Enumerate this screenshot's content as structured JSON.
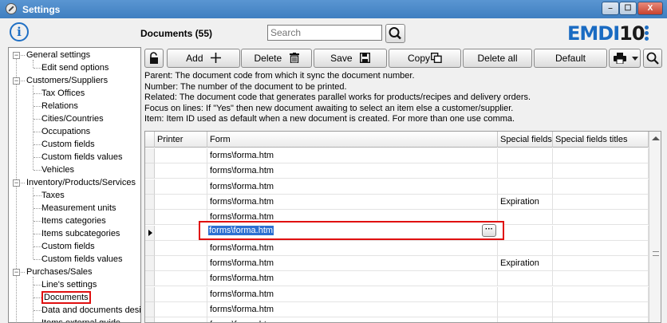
{
  "window": {
    "title": "Settings",
    "min": "–",
    "max": "☐",
    "close": "X"
  },
  "header": {
    "info_glyph": "i",
    "title": "Documents (55)",
    "search_placeholder": "Search",
    "logo_part1": "EMDI",
    "logo_part2": "10"
  },
  "toolbar": {
    "add": "Add",
    "delete": "Delete",
    "save": "Save",
    "copy": "Copy",
    "delete_all": "Delete all",
    "default": "Default"
  },
  "description": [
    "Parent: The document code from which it sync the document number.",
    "Number: The number of the document to be printed.",
    "Related: The document code that generates parallel works for products/recipes and delivery orders.",
    "Focus on lines: If \"Yes\" then new document awaiting to select an item else a customer/supplier.",
    "Item: Item ID used as default when a new document is created. For more than one use comma."
  ],
  "sidebar": {
    "items": [
      {
        "label": "General settings",
        "level": 0
      },
      {
        "label": "Edit send options",
        "level": 1
      },
      {
        "label": "Customers/Suppliers",
        "level": 0
      },
      {
        "label": "Tax Offices",
        "level": 1
      },
      {
        "label": "Relations",
        "level": 1
      },
      {
        "label": "Cities/Countries",
        "level": 1
      },
      {
        "label": "Occupations",
        "level": 1
      },
      {
        "label": "Custom fields",
        "level": 1
      },
      {
        "label": "Custom fields values",
        "level": 1
      },
      {
        "label": "Vehicles",
        "level": 1
      },
      {
        "label": "Inventory/Products/Services",
        "level": 0
      },
      {
        "label": "Taxes",
        "level": 1
      },
      {
        "label": "Measurement units",
        "level": 1
      },
      {
        "label": "Items categories",
        "level": 1
      },
      {
        "label": "Items subcategories",
        "level": 1
      },
      {
        "label": "Custom fields",
        "level": 1
      },
      {
        "label": "Custom fields values",
        "level": 1
      },
      {
        "label": "Purchases/Sales",
        "level": 0
      },
      {
        "label": "Line's settings",
        "level": 1
      },
      {
        "label": "Documents",
        "level": 1,
        "selected": true
      },
      {
        "label": "Data and documents desi",
        "level": 1
      },
      {
        "label": "Items external guide",
        "level": 1
      }
    ]
  },
  "grid": {
    "columns": [
      "Printer",
      "Form",
      "Special fields",
      "Special fields titles"
    ],
    "rows": [
      {
        "printer": "",
        "form": "forms\\forma.htm",
        "special": "",
        "titles": ""
      },
      {
        "printer": "",
        "form": "forms\\forma.htm",
        "special": "",
        "titles": ""
      },
      {
        "printer": "",
        "form": "forms\\forma.htm",
        "special": "",
        "titles": ""
      },
      {
        "printer": "",
        "form": "forms\\forma.htm",
        "special": "Expiration",
        "titles": ""
      },
      {
        "printer": "",
        "form": "forms\\forma.htm",
        "special": "",
        "titles": ""
      },
      {
        "printer": "",
        "form": "forms\\forma.htm",
        "special": "",
        "titles": "",
        "editing": true
      },
      {
        "printer": "",
        "form": "forms\\forma.htm",
        "special": "",
        "titles": ""
      },
      {
        "printer": "",
        "form": "forms\\forma.htm",
        "special": "Expiration",
        "titles": ""
      },
      {
        "printer": "",
        "form": "forms\\forma.htm",
        "special": "",
        "titles": ""
      },
      {
        "printer": "",
        "form": "forms\\forma.htm",
        "special": "",
        "titles": ""
      },
      {
        "printer": "",
        "form": "forms\\forma.htm",
        "special": "",
        "titles": ""
      },
      {
        "printer": "",
        "form": "forms\\forma.htm",
        "special": "",
        "titles": ""
      }
    ],
    "ellipsis": "···"
  }
}
